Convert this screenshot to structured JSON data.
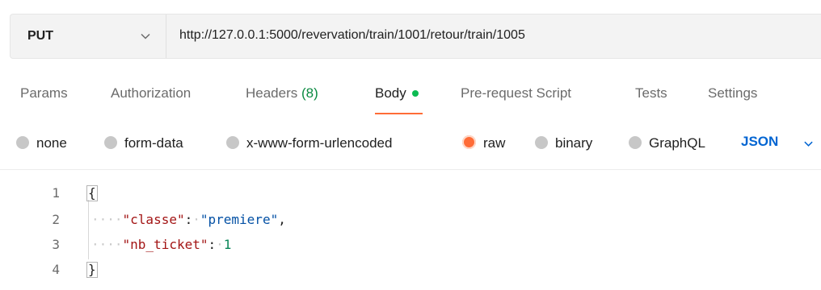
{
  "request": {
    "method": "PUT",
    "url": "http://127.0.0.1:5000/revervation/train/1001/retour/train/1005"
  },
  "tabs": [
    {
      "label": "Params"
    },
    {
      "label": "Authorization"
    },
    {
      "label": "Headers",
      "count": "(8)"
    },
    {
      "label": "Body",
      "active": true
    },
    {
      "label": "Pre-request Script"
    },
    {
      "label": "Tests"
    },
    {
      "label": "Settings"
    }
  ],
  "body_types": [
    {
      "label": "none"
    },
    {
      "label": "form-data"
    },
    {
      "label": "x-www-form-urlencoded"
    },
    {
      "label": "raw",
      "selected": true
    },
    {
      "label": "binary"
    },
    {
      "label": "GraphQL"
    }
  ],
  "raw_language": "JSON",
  "editor": {
    "line_numbers": [
      "1",
      "2",
      "3",
      "4"
    ],
    "open_brace": "{",
    "close_brace": "}",
    "dots": "····",
    "fields": [
      {
        "key": "\"classe\"",
        "value": "\"premiere\"",
        "value_type": "string",
        "comma": ","
      },
      {
        "key": "\"nb_ticket\"",
        "value": "1",
        "value_type": "number",
        "comma": ""
      }
    ]
  },
  "colors": {
    "accent": "#ff6c37",
    "body_dot": "#0cbb52",
    "headers_count": "#0a8a41",
    "json_link": "#0265d2",
    "json_key": "#a31515",
    "json_string": "#0451a5",
    "json_number": "#098658"
  }
}
